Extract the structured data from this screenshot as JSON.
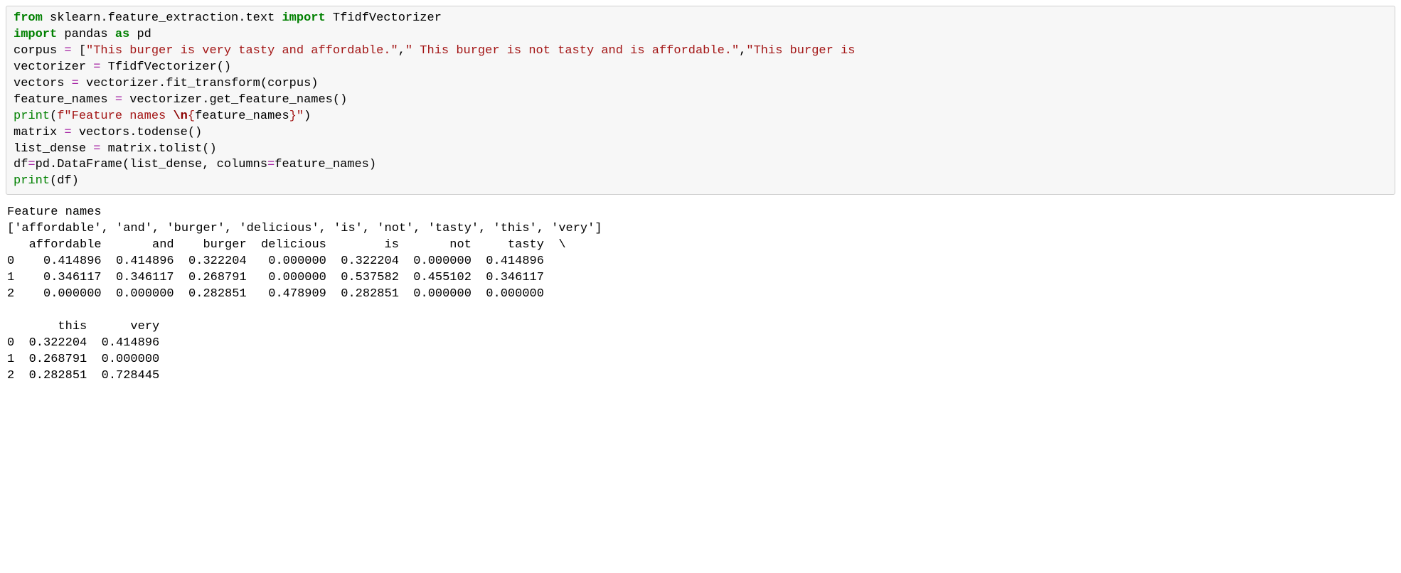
{
  "code": {
    "line1": {
      "from": "from",
      "mod": " sklearn.feature_extraction.text ",
      "import": "import",
      "obj": " TfidfVectorizer"
    },
    "line2": {
      "import": "import",
      "mod": " pandas ",
      "as": "as",
      "alias": " pd"
    },
    "line3": {
      "var": "corpus ",
      "eq": "=",
      "sp": " ",
      "ob": "[",
      "s1": "\"This burger is very tasty and affordable.\"",
      "c1": ",",
      "s2": "\" This burger is not tasty and is affordable.\"",
      "c2": ",",
      "s3": "\"This burger is "
    },
    "line4": {
      "var": "vectorizer ",
      "eq": "=",
      "rest": " TfidfVectorizer()"
    },
    "line5": {
      "var": "vectors ",
      "eq": "=",
      "rest": " vectorizer.fit_transform(corpus)"
    },
    "line6": {
      "var": "feature_names ",
      "eq": "=",
      "rest": " vectorizer.get_feature_names()"
    },
    "line7": {
      "print": "print",
      "op": "(",
      "pre": "f\"Feature names ",
      "esc": "\\n",
      "brace": "{",
      "expr": "feature_names",
      "brace2": "}",
      "q": "\"",
      "cp": ")"
    },
    "line8": {
      "var": "matrix ",
      "eq": "=",
      "rest": " vectors.todense()"
    },
    "line9": {
      "var": "list_dense ",
      "eq": "=",
      "rest": " matrix.tolist()"
    },
    "line10": {
      "var": "df",
      "eq": "=",
      "rest": "pd.DataFrame(list_dense, columns",
      "eq2": "=",
      "rest2": "feature_names)"
    },
    "line11": {
      "print": "print",
      "rest": "(df)"
    }
  },
  "output": {
    "l1": "Feature names ",
    "l2": "['affordable', 'and', 'burger', 'delicious', 'is', 'not', 'tasty', 'this', 'very']",
    "l3": "   affordable       and    burger  delicious        is       not     tasty  \\",
    "l4": "0    0.414896  0.414896  0.322204   0.000000  0.322204  0.000000  0.414896   ",
    "l5": "1    0.346117  0.346117  0.268791   0.000000  0.537582  0.455102  0.346117   ",
    "l6": "2    0.000000  0.000000  0.282851   0.478909  0.282851  0.000000  0.000000   ",
    "l7": "",
    "l8": "       this      very  ",
    "l9": "0  0.322204  0.414896  ",
    "l10": "1  0.268791  0.000000  ",
    "l11": "2  0.282851  0.728445  "
  },
  "chart_data": {
    "type": "table",
    "title": "TF-IDF matrix",
    "columns": [
      "affordable",
      "and",
      "burger",
      "delicious",
      "is",
      "not",
      "tasty",
      "this",
      "very"
    ],
    "rows": [
      [
        0.414896,
        0.414896,
        0.322204,
        0.0,
        0.322204,
        0.0,
        0.414896,
        0.322204,
        0.414896
      ],
      [
        0.346117,
        0.346117,
        0.268791,
        0.0,
        0.537582,
        0.455102,
        0.346117,
        0.268791,
        0.0
      ],
      [
        0.0,
        0.0,
        0.282851,
        0.478909,
        0.282851,
        0.0,
        0.0,
        0.282851,
        0.728445
      ]
    ]
  }
}
